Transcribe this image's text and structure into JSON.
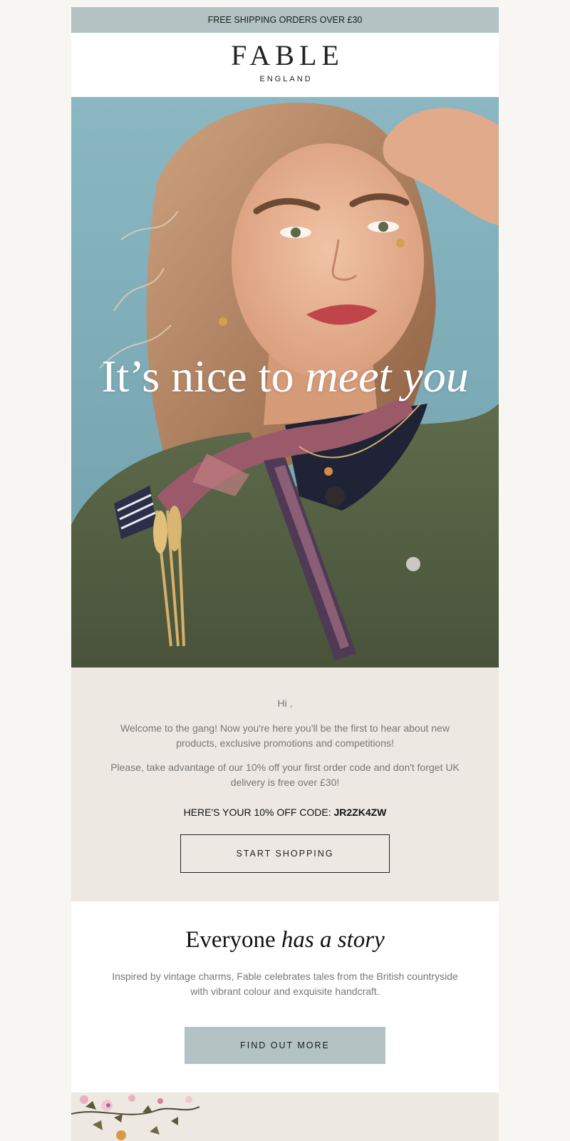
{
  "topbar": {
    "text": "FREE SHIPPING ORDERS OVER £30"
  },
  "brand": {
    "name": "FABLE",
    "sub": "ENGLAND"
  },
  "hero": {
    "title_plain": "It’s nice to ",
    "title_italic": "meet you"
  },
  "welcome": {
    "greeting": "Hi ,",
    "p1": "Welcome to the gang! Now you're here you'll be the first to hear about new products, exclusive promotions and competitions!",
    "p2": "Please, take advantage of our 10% off your first order code and don't forget UK delivery is free over £30!",
    "code_label": "HERE'S YOUR 10% OFF CODE: ",
    "code_value": "JR2ZK4ZW",
    "button": "START SHOPPING"
  },
  "story": {
    "title_plain": "Everyone ",
    "title_italic": "has a story",
    "text": "Inspired by vintage charms, Fable celebrates tales from the British countryside with vibrant colour and exquisite handcraft.",
    "button": "FIND OUT MORE"
  },
  "colors": {
    "accent": "#b3c3c3",
    "beige": "#ede9e2",
    "page": "#f7f6f2"
  }
}
